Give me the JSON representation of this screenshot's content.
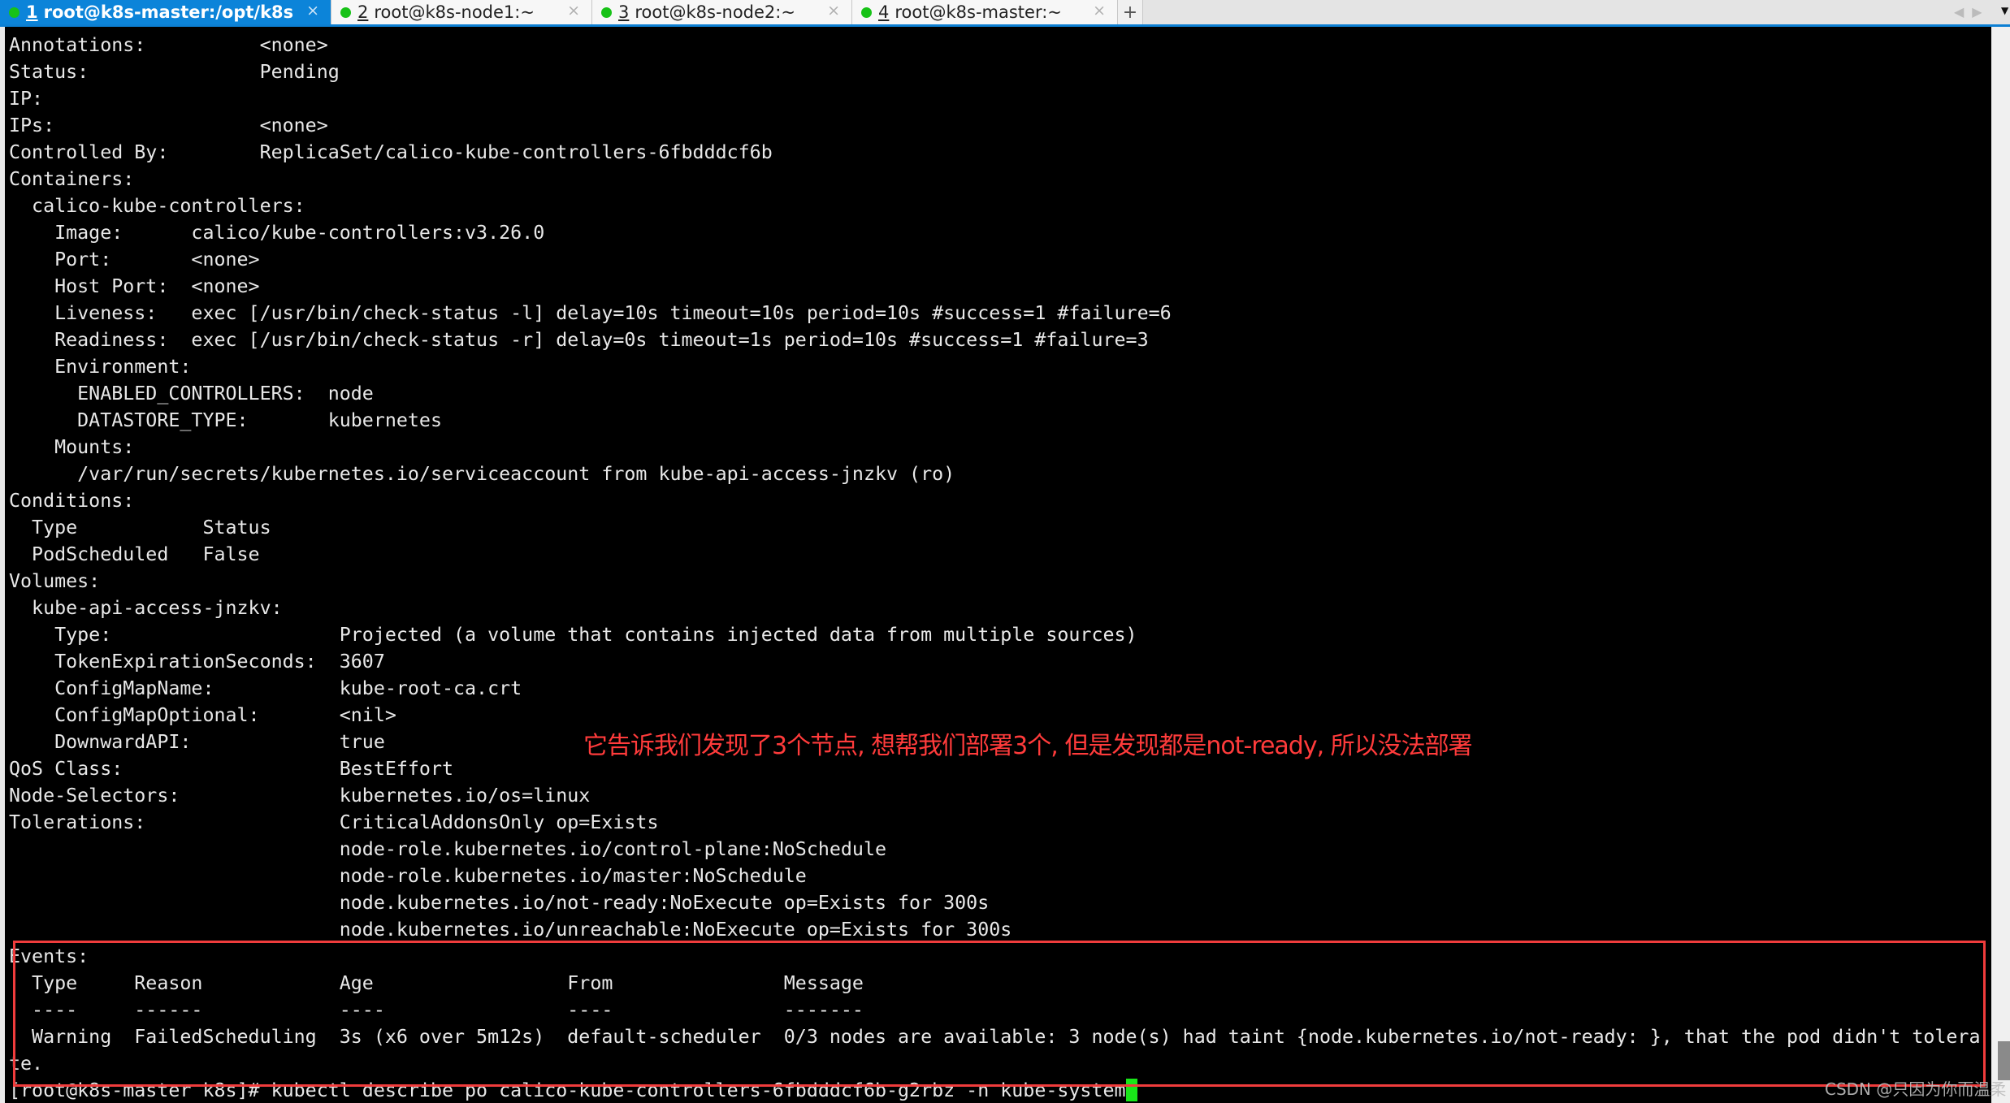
{
  "tabs": [
    {
      "number": "1",
      "title": "root@k8s-master:/opt/k8s",
      "active": true,
      "close": "×"
    },
    {
      "number": "2",
      "title": "root@k8s-node1:~",
      "active": false,
      "close": "×"
    },
    {
      "number": "3",
      "title": "root@k8s-node2:~",
      "active": false,
      "close": "×"
    },
    {
      "number": "4",
      "title": "root@k8s-master:~",
      "active": false,
      "close": "×"
    }
  ],
  "tabbar": {
    "new_tab": "+",
    "nav_arrows": "◀▶",
    "menu": "▼"
  },
  "terminal": {
    "lines": [
      "Annotations:          <none>",
      "Status:               Pending",
      "IP:",
      "IPs:                  <none>",
      "Controlled By:        ReplicaSet/calico-kube-controllers-6fbdddcf6b",
      "Containers:",
      "  calico-kube-controllers:",
      "    Image:      calico/kube-controllers:v3.26.0",
      "    Port:       <none>",
      "    Host Port:  <none>",
      "    Liveness:   exec [/usr/bin/check-status -l] delay=10s timeout=10s period=10s #success=1 #failure=6",
      "    Readiness:  exec [/usr/bin/check-status -r] delay=0s timeout=1s period=10s #success=1 #failure=3",
      "    Environment:",
      "      ENABLED_CONTROLLERS:  node",
      "      DATASTORE_TYPE:       kubernetes",
      "    Mounts:",
      "      /var/run/secrets/kubernetes.io/serviceaccount from kube-api-access-jnzkv (ro)",
      "Conditions:",
      "  Type           Status",
      "  PodScheduled   False",
      "Volumes:",
      "  kube-api-access-jnzkv:",
      "    Type:                    Projected (a volume that contains injected data from multiple sources)",
      "    TokenExpirationSeconds:  3607",
      "    ConfigMapName:           kube-root-ca.crt",
      "    ConfigMapOptional:       <nil>",
      "    DownwardAPI:             true",
      "QoS Class:                   BestEffort",
      "Node-Selectors:              kubernetes.io/os=linux",
      "Tolerations:                 CriticalAddonsOnly op=Exists",
      "                             node-role.kubernetes.io/control-plane:NoSchedule",
      "                             node-role.kubernetes.io/master:NoSchedule",
      "                             node.kubernetes.io/not-ready:NoExecute op=Exists for 300s",
      "                             node.kubernetes.io/unreachable:NoExecute op=Exists for 300s",
      "Events:",
      "  Type     Reason            Age                 From               Message",
      "  ----     ------            ----                ----               -------",
      "  Warning  FailedScheduling  3s (x6 over 5m12s)  default-scheduler  0/3 nodes are available: 3 node(s) had taint {node.kubernetes.io/not-ready: }, that the pod didn't tolera",
      "te.",
      "[root@k8s-master k8s]# kubectl describe po calico-kube-controllers-6fbdddcf6b-g2rbz -n kube-system"
    ]
  },
  "annotation": {
    "text": "它告诉我们发现了3个节点, 想帮我们部署3个, 但是发现都是not-ready, 所以没法部署",
    "color": "#ff3b3b"
  },
  "highlight_box": {
    "color": "#f03c3c",
    "covers": "Events section"
  },
  "watermark": "CSDN @只因为你而温柔",
  "colors": {
    "tab_active": "#0c84d9",
    "status_dot": "#17c217",
    "cursor": "#19e619",
    "terminal_bg": "#000000",
    "terminal_fg": "#e8e8e8"
  }
}
